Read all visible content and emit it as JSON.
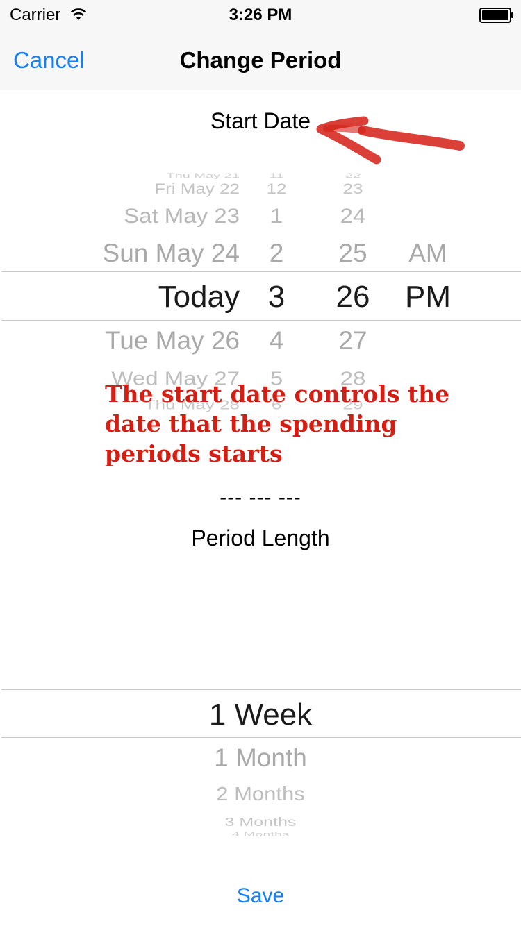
{
  "status_bar": {
    "carrier": "Carrier",
    "time": "3:26 PM"
  },
  "nav": {
    "cancel_label": "Cancel",
    "title": "Change Period"
  },
  "start_date": {
    "label": "Start Date",
    "picker": {
      "dates": {
        "m4": "Thu May 21",
        "m3": "Fri May 22",
        "m2": "Sat May 23",
        "m1": "Sun May 24",
        "selected": "Today",
        "p1": "Tue May 26",
        "p2": "Wed May 27",
        "p3": "Thu May 28"
      },
      "hours": {
        "m4": "11",
        "m3": "12",
        "m2": "1",
        "m1": "2",
        "selected": "3",
        "p1": "4",
        "p2": "5",
        "p3": "6"
      },
      "minutes": {
        "m4": "22",
        "m3": "23",
        "m2": "24",
        "m1": "25",
        "selected": "26",
        "p1": "27",
        "p2": "28",
        "p3": "29"
      },
      "ampm": {
        "m1": "AM",
        "selected": "PM"
      }
    }
  },
  "annotation": {
    "text": "The start date controls the date that the spending periods starts",
    "color": "#d41e14"
  },
  "separator": "--- --- ---",
  "period_length": {
    "label": "Period Length",
    "options": [
      "1 Week",
      "1 Month",
      "2 Months",
      "3 Months",
      "4 Months"
    ],
    "selected": "1 Week"
  },
  "save_label": "Save",
  "colors": {
    "accent": "#157efb",
    "annotation": "#d41e14"
  }
}
